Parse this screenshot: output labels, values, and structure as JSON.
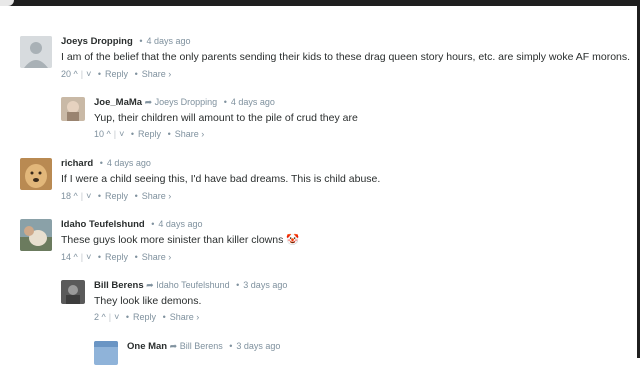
{
  "comments": [
    {
      "author": "Joeys Dropping",
      "time": "4 days ago",
      "text": "I am of the belief that the only parents sending their kids to these drag queen story hours, etc. are simply woke AF morons.",
      "votes": "20",
      "reply": "Reply",
      "share": "Share ›"
    },
    {
      "author": "Joe_MaMa",
      "reply_to": "Joeys Dropping",
      "time": "4 days ago",
      "text": "Yup, their children will amount to the pile of crud they are",
      "votes": "10",
      "reply": "Reply",
      "share": "Share ›"
    },
    {
      "author": "richard",
      "time": "4 days ago",
      "text": "If I were a child seeing this, I'd have bad dreams. This is child abuse.",
      "votes": "18",
      "reply": "Reply",
      "share": "Share ›"
    },
    {
      "author": "Idaho Teufelshund",
      "time": "4 days ago",
      "text": "These guys look more sinister than killer clowns 🤡",
      "votes": "14",
      "reply": "Reply",
      "share": "Share ›"
    },
    {
      "author": "Bill Berens",
      "reply_to": "Idaho Teufelshund",
      "time": "3 days ago",
      "text": "They look like demons.",
      "votes": "2",
      "reply": "Reply",
      "share": "Share ›"
    },
    {
      "author": "One Man",
      "reply_to": "Bill Berens",
      "time": "3 days ago"
    }
  ],
  "glyphs": {
    "bullet": "•",
    "upvote": "^",
    "downvote": "˅",
    "divider": "|",
    "reply_arrow": "➦"
  }
}
